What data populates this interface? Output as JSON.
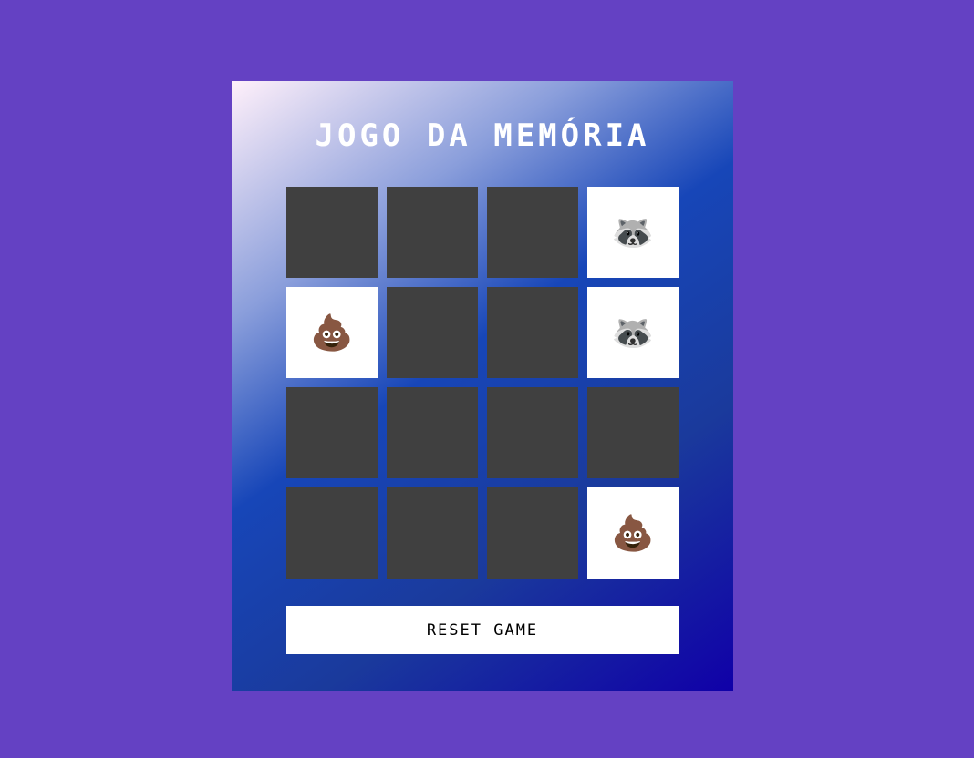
{
  "title": "JOGO DA MEMÓRIA",
  "reset_label": "RESET GAME",
  "cards": [
    {
      "open": false,
      "emoji": ""
    },
    {
      "open": false,
      "emoji": ""
    },
    {
      "open": false,
      "emoji": ""
    },
    {
      "open": true,
      "emoji": "🦝"
    },
    {
      "open": true,
      "emoji": "💩"
    },
    {
      "open": false,
      "emoji": ""
    },
    {
      "open": false,
      "emoji": ""
    },
    {
      "open": true,
      "emoji": "🦝"
    },
    {
      "open": false,
      "emoji": ""
    },
    {
      "open": false,
      "emoji": ""
    },
    {
      "open": false,
      "emoji": ""
    },
    {
      "open": false,
      "emoji": ""
    },
    {
      "open": false,
      "emoji": ""
    },
    {
      "open": false,
      "emoji": ""
    },
    {
      "open": false,
      "emoji": ""
    },
    {
      "open": true,
      "emoji": "💩"
    }
  ]
}
